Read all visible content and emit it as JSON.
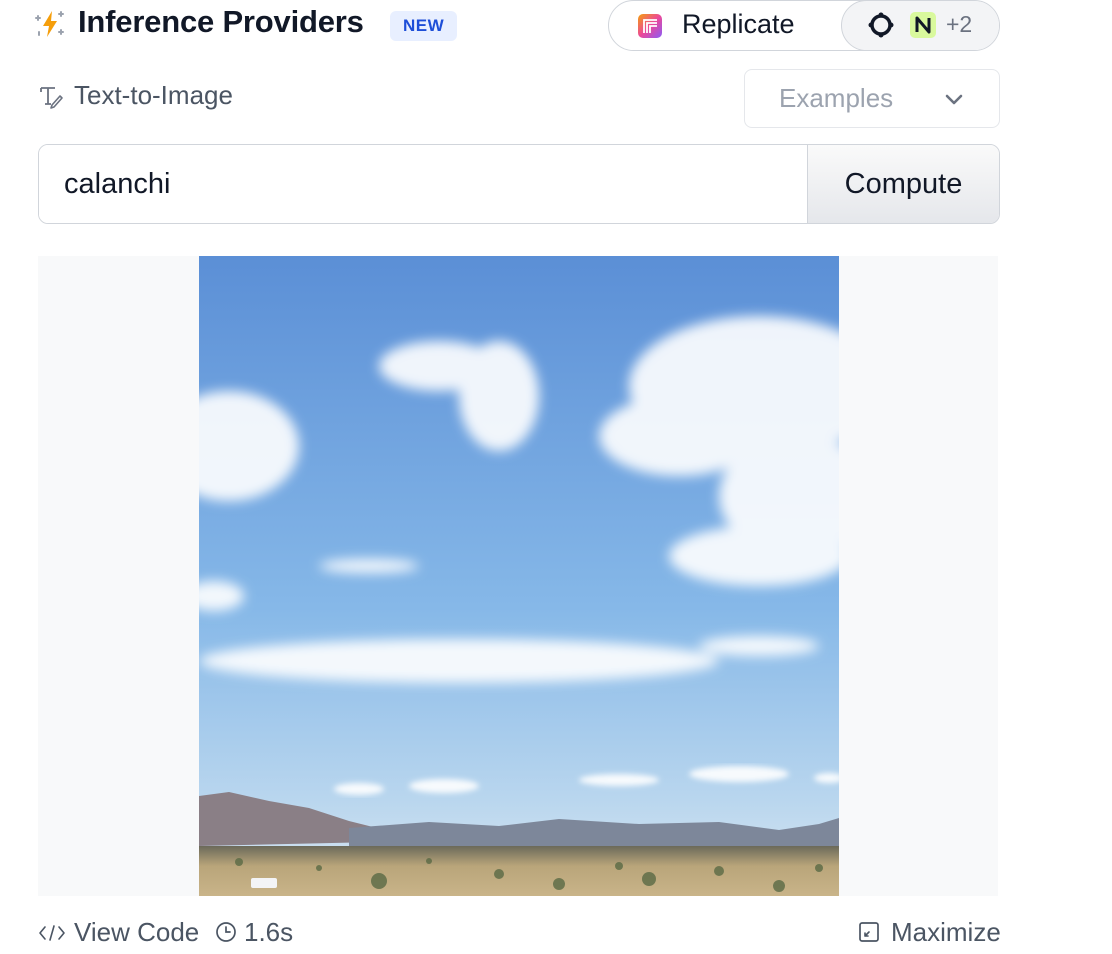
{
  "header": {
    "title": "Inference Providers",
    "badge": "NEW",
    "providers": {
      "selected": "Replicate",
      "more_count": "+2"
    }
  },
  "task": {
    "label": "Text-to-Image",
    "examples_placeholder": "Examples"
  },
  "prompt": {
    "value": "calanchi",
    "compute_label": "Compute"
  },
  "output": {
    "image_description_icon": "generated-landscape-image"
  },
  "footer": {
    "view_code_label": "View Code",
    "duration": "1.6s",
    "maximize_label": "Maximize"
  },
  "colors": {
    "badge_bg": "#e8efff",
    "badge_text": "#1d4ed8",
    "n_logo_bg": "#d9f99d",
    "spark_color": "#f59e0b"
  }
}
